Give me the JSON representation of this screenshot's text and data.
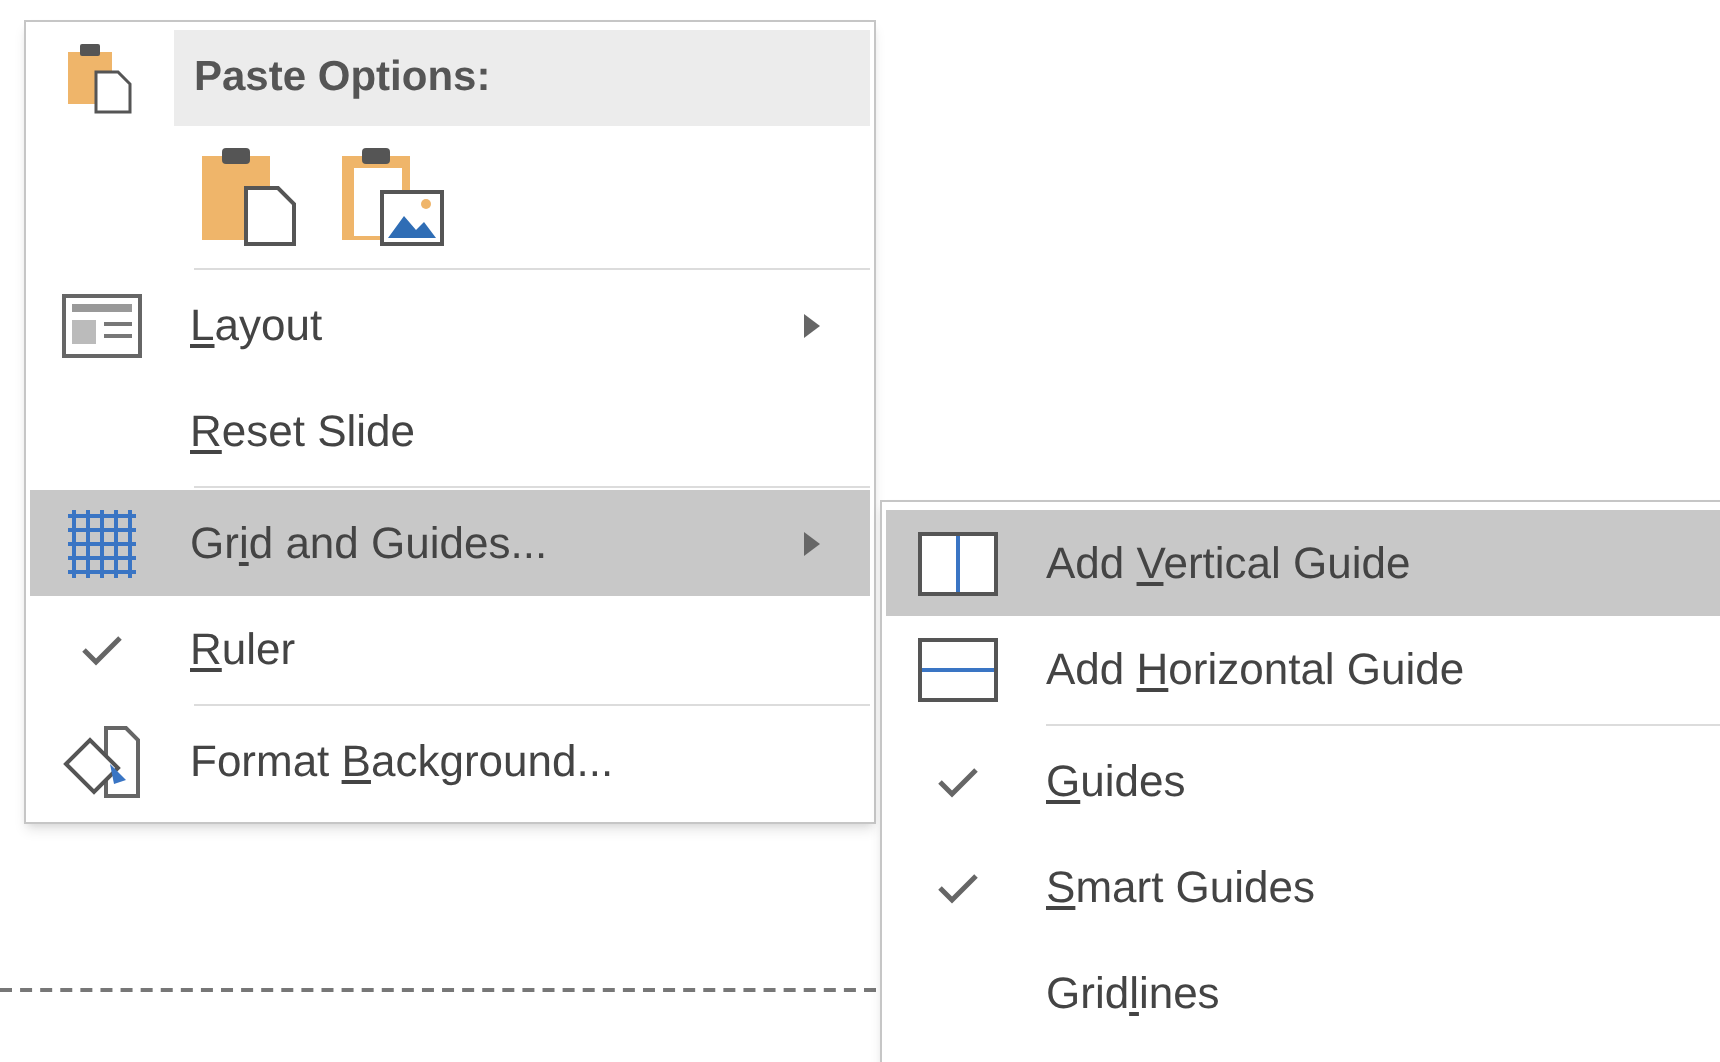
{
  "context_menu": {
    "items": [
      {
        "kind": "header",
        "label": "Paste Options:"
      },
      {
        "kind": "paste_buttons"
      },
      {
        "kind": "separator"
      },
      {
        "kind": "item",
        "key": "L",
        "after": "ayout",
        "checked": false,
        "has_submenu": true,
        "selected": false
      },
      {
        "kind": "item",
        "key": "R",
        "after": "eset Slide",
        "checked": false,
        "has_submenu": false,
        "selected": false
      },
      {
        "kind": "separator"
      },
      {
        "kind": "item",
        "before": "Gr",
        "key": "i",
        "after": "d and Guides...",
        "checked": false,
        "has_submenu": true,
        "selected": true
      },
      {
        "kind": "item",
        "key": "R",
        "after": "uler",
        "checked": true,
        "has_submenu": false,
        "selected": false
      },
      {
        "kind": "separator"
      },
      {
        "kind": "item",
        "before": "Format ",
        "key": "B",
        "after": "ackground...",
        "checked": false,
        "has_submenu": false,
        "selected": false
      }
    ]
  },
  "submenu": {
    "items": [
      {
        "kind": "item",
        "before": "Add ",
        "key": "V",
        "after": "ertical Guide",
        "checked": false,
        "selected": true
      },
      {
        "kind": "item",
        "before": "Add ",
        "key": "H",
        "after": "orizontal Guide",
        "checked": false,
        "selected": false
      },
      {
        "kind": "separator"
      },
      {
        "kind": "item",
        "key": "G",
        "after": "uides",
        "checked": true,
        "selected": false
      },
      {
        "kind": "item",
        "key": "S",
        "after": "mart Guides",
        "checked": true,
        "selected": false
      },
      {
        "kind": "item",
        "before": "Grid",
        "key": "l",
        "after": "ines",
        "checked": false,
        "selected": false
      }
    ]
  }
}
